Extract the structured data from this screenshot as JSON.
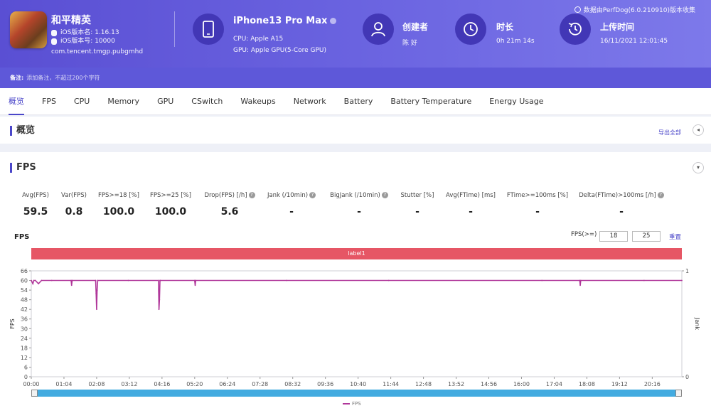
{
  "header": {
    "app_name": "和平精英",
    "ios_version_name": "iOS版本名: 1.16.13",
    "ios_version_code": "iOS版本号: 10000",
    "bundle_id": "com.tencent.tmgp.pubgmhd",
    "device_name": "iPhone13 Pro Max",
    "cpu": "CPU: Apple A15",
    "gpu": "GPU: Apple GPU(5-Core GPU)",
    "creator_title": "创建者",
    "creator_value": "陈 好",
    "duration_title": "时长",
    "duration_value": "0h 21m 14s",
    "upload_title": "上传时间",
    "upload_value": "16/11/2021 12:01:45",
    "collector": "数据由PerfDog(6.0.210910)版本收集",
    "accent": "#5a4fd3"
  },
  "notes": {
    "label": "备注:",
    "placeholder": "添加备注，不超过200个字符"
  },
  "tabs": [
    "概览",
    "FPS",
    "CPU",
    "Memory",
    "GPU",
    "CSwitch",
    "Wakeups",
    "Network",
    "Battery",
    "Battery Temperature",
    "Energy Usage"
  ],
  "overview": {
    "title": "概览",
    "export_label": "导出全部"
  },
  "fps_panel": {
    "title": "FPS",
    "metrics": [
      {
        "label": "Avg(FPS)",
        "value": "59.5",
        "help": false
      },
      {
        "label": "Var(FPS)",
        "value": "0.8",
        "help": false
      },
      {
        "label": "FPS>=18 [%]",
        "value": "100.0",
        "help": false
      },
      {
        "label": "FPS>=25 [%]",
        "value": "100.0",
        "help": false
      },
      {
        "label": "Drop(FPS) [/h]",
        "value": "5.6",
        "help": true
      },
      {
        "label": "Jank (/10min)",
        "value": "-",
        "help": true
      },
      {
        "label": "BigJank (/10min)",
        "value": "-",
        "help": true
      },
      {
        "label": "Stutter [%]",
        "value": "-",
        "help": false
      },
      {
        "label": "Avg(FTime) [ms]",
        "value": "-",
        "help": false
      },
      {
        "label": "FTime>=100ms [%]",
        "value": "-",
        "help": false
      },
      {
        "label": "Delta(FTime)>100ms [/h]",
        "value": "-",
        "help": true
      }
    ],
    "chart_title": "FPS",
    "threshold_label": "FPS(>=)",
    "threshold_1": "18",
    "threshold_2": "25",
    "reset_label": "重置",
    "band_label": "label1",
    "legend": "FPS",
    "band_color": "#e65665",
    "series_color": "#b0379a"
  },
  "chart_data": {
    "type": "line",
    "title": "FPS",
    "ylabel": "FPS",
    "y2label": "Jank",
    "ylim": [
      0,
      66
    ],
    "y2lim": [
      0,
      1
    ],
    "yticks": [
      0,
      6,
      12,
      18,
      24,
      30,
      36,
      42,
      48,
      54,
      60,
      66
    ],
    "y2ticks": [
      0,
      1
    ],
    "xlim": [
      0,
      1274
    ],
    "xticks": [
      "00:00",
      "01:04",
      "02:08",
      "03:12",
      "04:16",
      "05:20",
      "06:24",
      "07:28",
      "08:32",
      "09:36",
      "10:40",
      "11:44",
      "12:48",
      "13:52",
      "14:56",
      "16:00",
      "17:04",
      "18:08",
      "19:12",
      "20:16"
    ],
    "x_tick_seconds": [
      0,
      64,
      128,
      192,
      256,
      320,
      384,
      448,
      512,
      576,
      640,
      704,
      768,
      832,
      896,
      960,
      1024,
      1088,
      1152,
      1216
    ],
    "series": [
      {
        "name": "FPS",
        "x_seconds": [
          0,
          3,
          5,
          8,
          14,
          20,
          40,
          78,
          79,
          80,
          126,
          127,
          128,
          129,
          130,
          190,
          249,
          250,
          251,
          252,
          253,
          320,
          321,
          322,
          500,
          700,
          1000,
          1074,
          1075,
          1076,
          1200,
          1274
        ],
        "values": [
          60,
          58,
          60,
          60,
          58,
          60,
          60,
          60,
          57,
          60,
          60,
          52,
          42,
          54,
          60,
          60,
          60,
          42,
          48,
          60,
          60,
          60,
          57,
          60,
          60,
          60,
          60,
          60,
          57,
          60,
          60,
          60
        ]
      }
    ]
  }
}
